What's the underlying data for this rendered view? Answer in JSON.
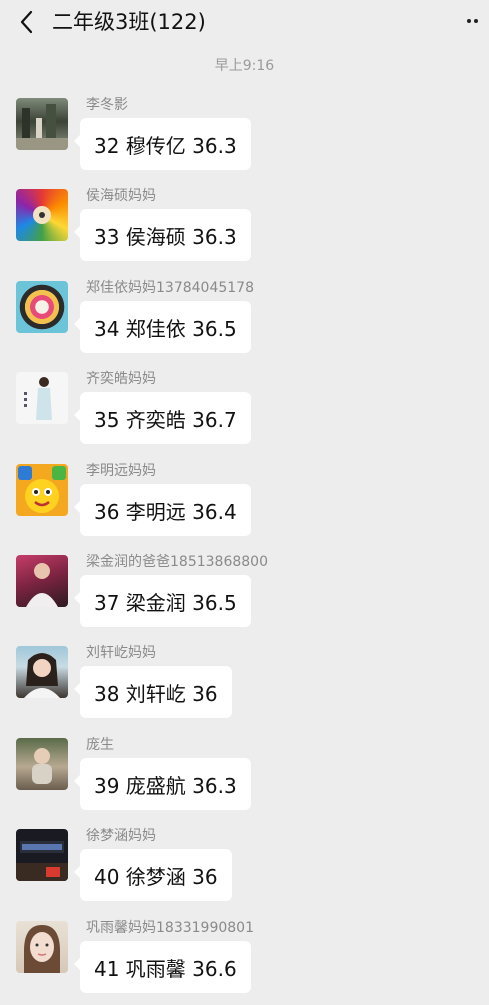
{
  "header": {
    "title": "二年级3班(122)"
  },
  "time_divider": "早上9:16",
  "messages": [
    {
      "sender": "李冬影",
      "text": "32 穆传亿 36.3",
      "avatar": "landscape-photo-avatar"
    },
    {
      "sender": "侯海硕妈妈",
      "text": "33 侯海硕 36.3",
      "avatar": "colored-pencils-avatar"
    },
    {
      "sender": "郑佳依妈妈13784045178",
      "text": "34 郑佳依 36.5",
      "avatar": "color-wheel-avatar"
    },
    {
      "sender": "齐奕皓妈妈",
      "text": "35 齐奕皓 36.7",
      "avatar": "woman-portrait-avatar"
    },
    {
      "sender": "李明远妈妈",
      "text": "36 李明远 36.4",
      "avatar": "cartoon-game-avatar"
    },
    {
      "sender": "梁金润的爸爸18513868800",
      "text": "37 梁金润 36.5",
      "avatar": "person-photo-avatar"
    },
    {
      "sender": "刘轩屹妈妈",
      "text": "38 刘轩屹 36",
      "avatar": "woman-photo-avatar"
    },
    {
      "sender": "庞生",
      "text": "39 庞盛航 36.3",
      "avatar": "child-photo-avatar"
    },
    {
      "sender": "徐梦涵妈妈",
      "text": "40 徐梦涵 36",
      "avatar": "shop-sign-avatar"
    },
    {
      "sender": "巩雨馨妈妈18331990801",
      "text": "41 巩雨馨 36.6",
      "avatar": "woman-face-avatar"
    }
  ],
  "colors": {
    "background": "#ededed",
    "bubble": "#ffffff",
    "sender_text": "#8a8a8a",
    "time_text": "#9a9a9a"
  }
}
